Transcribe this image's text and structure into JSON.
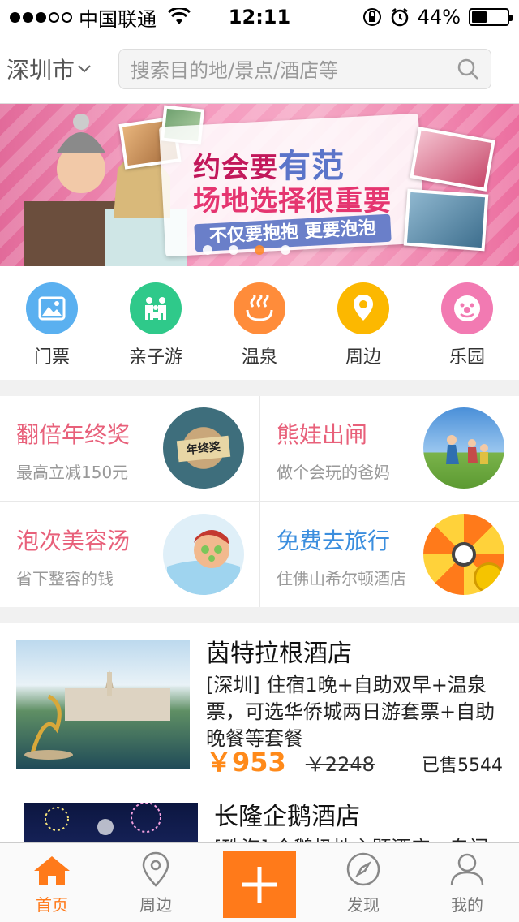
{
  "status_bar": {
    "carrier": "中国联通",
    "time": "12:11",
    "battery_percent": "44%",
    "battery_level": 0.44,
    "signal_bars_filled": 3,
    "signal_bars_total": 5
  },
  "header": {
    "city": "深圳市",
    "search_placeholder": "搜索目的地/景点/酒店等"
  },
  "banner": {
    "title_line1_prefix": "约会要",
    "title_line1_highlight": "有范",
    "title_line2": "场地选择很重要",
    "subtitle": "不仅要抱抱 更要泡泡",
    "slide_count": 4,
    "active_slide_index": 2
  },
  "categories": [
    {
      "label": "门票",
      "icon": "ticket-icon",
      "color": "#5ab0f0"
    },
    {
      "label": "亲子游",
      "icon": "family-icon",
      "color": "#2fc98a"
    },
    {
      "label": "温泉",
      "icon": "hot-spring-icon",
      "color": "#ff8c3a"
    },
    {
      "label": "周边",
      "icon": "location-pin-icon",
      "color": "#fcb800"
    },
    {
      "label": "乐园",
      "icon": "clown-icon",
      "color": "#f27ab2"
    }
  ],
  "promos": [
    {
      "title": "翻倍年终奖",
      "subtitle": "最高立减150元",
      "title_color": "#e8607a"
    },
    {
      "title": "熊娃出闸",
      "subtitle": "做个会玩的爸妈",
      "title_color": "#e8607a"
    },
    {
      "title": "泡次美容汤",
      "subtitle": "省下整容的钱",
      "title_color": "#e8607a"
    },
    {
      "title": "免费去旅行",
      "subtitle": "住佛山希尔顿酒店",
      "title_color": "#3b8ede"
    }
  ],
  "promo_image_text": "年终奖",
  "hotels": [
    {
      "name": "茵特拉根酒店",
      "description": "[深圳] 住宿1晚+自助双早+温泉票，可选华侨城两日游套票+自助晚餐等套餐",
      "price": "￥953",
      "original_price": "￥2248",
      "sold": "已售5544"
    },
    {
      "name": "长隆企鹅酒店",
      "description": "[珠海] 企鹅极地主题酒店，专门"
    }
  ],
  "tabbar": {
    "tabs": [
      {
        "label": "首页",
        "icon": "home-icon",
        "active": true
      },
      {
        "label": "周边",
        "icon": "location-pin-icon",
        "active": false
      },
      {
        "label": "发现",
        "icon": "compass-icon",
        "active": false
      },
      {
        "label": "我的",
        "icon": "user-icon",
        "active": false
      }
    ],
    "center_button_icon": "plus-icon"
  },
  "colors": {
    "accent": "#ff7a1a",
    "price": "#ff8a1a"
  }
}
